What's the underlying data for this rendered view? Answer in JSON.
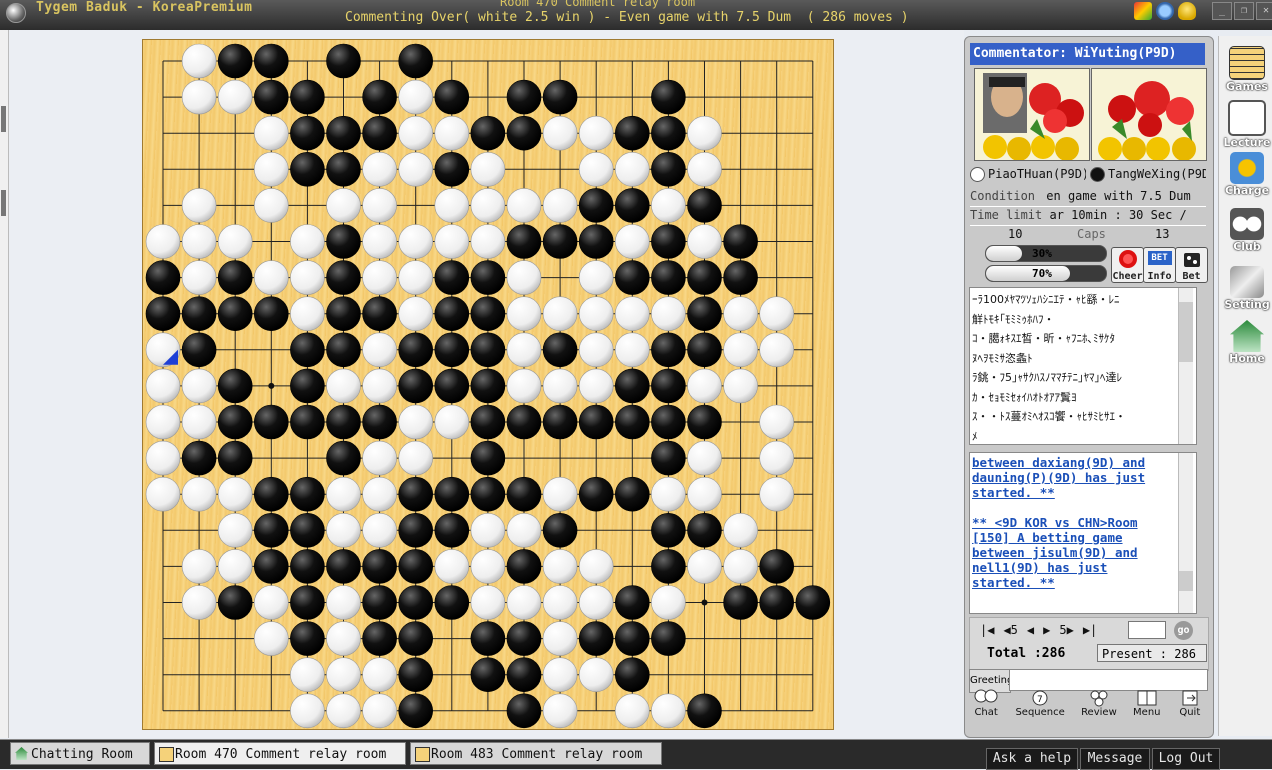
{
  "window": {
    "app_title": "Tygem Baduk - KoreaPremium",
    "room_title": "Room 470 Comment relay room",
    "status_line": "Commenting Over( white 2.5 win ) - Even game with 7.5 Dum  ( 286 moves )"
  },
  "board": {
    "size": 19,
    "last_move_marker": "blue-triangle",
    "last_move": [
      0,
      8
    ],
    "stones": [
      "-WBB-B-B-----------",
      "-WWBB-BWB-BB--B----",
      "---WBBBWWBBWWBBW---",
      "---WBBWWBW--WWBW---",
      "-W-W-WW-WWWWBBWB---",
      "WWW-WBWWWWBBBWBWB--",
      "BWBWWBWWBBW-WBBBB--",
      "BBBBWBBWBBWWWWWBWW-",
      "WB--BBWBBBWBWWBBWW-",
      "WWB-BWWBBBWWWBBWW--",
      "WWBBBBBWWBBBBBBB-W-",
      "WBB--BWW-B----BW-W-",
      "WWWBBWWBBBBWBBWW-W-",
      "--WBBWWBBWWB--BBW--",
      "-WWBBBBBWWBWW-BWWB-",
      "-WBWBWBBBWWWWBW-BBB",
      "---WBWBB-BBWBBB----",
      "----WWWB-BBWWB-----",
      "----WWWB--BW-WWB---"
    ]
  },
  "commentator": "Commentator: WiYuting(P9D)",
  "players": {
    "white": "PiaoTHuan(P9D)",
    "black": "TangWeXing(P9D)"
  },
  "game_info": {
    "condition_label": "Condition",
    "condition_value": "en game with 7.5 Dum",
    "time_label": "Time limit",
    "time_value": "ar 10min : 30 Sec /",
    "caps_white": "10",
    "caps_label": "Caps",
    "caps_black": "13"
  },
  "predictions": {
    "white_pct": "30%",
    "white_fraction": 0.3,
    "black_pct": "70%",
    "black_fraction": 0.7
  },
  "action_buttons": {
    "cheer": "Cheer",
    "info": "Info",
    "bet": "Bet",
    "bet_badge": "BET"
  },
  "garbled_chat": [
    "ｰﾗ100ﾒﾔﾏﾂｿｪﾊｼﾆｴﾃ・ｬﾋ繇・ﾚﾆ",
    "觧ﾄﾓｷ｢ﾓﾐﾐｩﾎﾊﾌ・",
    "ｺ・臈ｫｷｽｴ皙・昕・ｬﾌﾆﾎ､ﾐｻｹﾀ",
    "ﾇﾍｦﾓﾐｻ恣螽ﾄ",
    "ﾗ銚・ﾌ5｣ｬｻｸﾊｽﾉﾏﾏﾁﾃﾆ｣ﾔﾏ｣ﾍ達ﾚ",
    "ｶ・ｾｮﾓﾐｾｫｲﾊｵﾄｵｱｱ鬒ﾖ",
    "ｽ・・ﾄｽ蔓ｵﾐﾍｵｽｺ饗・ｬﾋｻﾐﾋｻｴ・",
    "ﾒ"
  ],
  "system_chat": {
    "line1": "between daxiang(9D) and",
    "line2": "dauning(P)(9D) has just",
    "line3": "started. **",
    "line4": "** <9D KOR vs CHN>Room",
    "line5": "[150] A betting game",
    "line6": "between jisulm(9D) and",
    "line7": "nell1(9D) has just",
    "line8": "started. **"
  },
  "navigation": {
    "first": "|◀",
    "back5": "◀5",
    "prev": "◀",
    "next": "▶",
    "fwd5": "5▶",
    "last": "▶|",
    "move_input": "",
    "go_label": "go",
    "total_label": "Total :286",
    "present_label": "Present : 286"
  },
  "greeting": {
    "button": "Greeting",
    "input": ""
  },
  "bottom_icons": [
    "Chat",
    "Sequence",
    "Review",
    "Menu",
    "Quit"
  ],
  "sidebar": [
    "Games",
    "Lecture",
    "Charge",
    "Club",
    "Setting",
    "Home"
  ],
  "taskbar": {
    "tabs": [
      "Chatting Room",
      "Room 470 Comment relay room",
      "Room 483 Comment relay room"
    ],
    "buttons": [
      "Ask a help",
      "Message",
      "Log Out"
    ]
  },
  "colors": {
    "board": "#f5cd76",
    "commentator_bar": "#3560c8",
    "system_chat_text": "#1a4fb8",
    "title_text": "#e8d06a"
  }
}
